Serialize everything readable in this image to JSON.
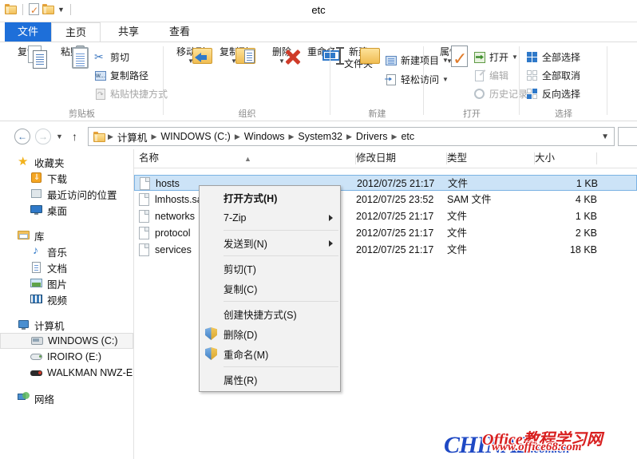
{
  "window": {
    "title": "etc",
    "quick_access": [
      "folder-icon",
      "new-doc-icon",
      "folder-icon",
      "dropdown-caret"
    ]
  },
  "ribbon": {
    "tabs": [
      {
        "id": "file",
        "label": "文件"
      },
      {
        "id": "home",
        "label": "主页"
      },
      {
        "id": "share",
        "label": "共享"
      },
      {
        "id": "view",
        "label": "查看"
      }
    ],
    "active_tab": "home",
    "groups": [
      {
        "id": "clipboard",
        "label": "剪贴板",
        "big_buttons": [
          {
            "id": "copy",
            "label": "复制",
            "icon": "copy-icon"
          },
          {
            "id": "paste",
            "label": "粘贴",
            "icon": "paste-icon"
          }
        ],
        "small_buttons": [
          {
            "id": "cut",
            "label": "剪切",
            "icon": "scissors-icon",
            "disabled": false
          },
          {
            "id": "copy-path",
            "label": "复制路径",
            "icon": "copy-path-icon",
            "disabled": false
          },
          {
            "id": "paste-shortcut",
            "label": "粘贴快捷方式",
            "icon": "paste-shortcut-icon",
            "disabled": true
          }
        ]
      },
      {
        "id": "organize",
        "label": "组织",
        "big_buttons": [
          {
            "id": "move-to",
            "label": "移动到",
            "icon": "move-to-icon"
          },
          {
            "id": "copy-to",
            "label": "复制到",
            "icon": "copy-to-icon"
          },
          {
            "id": "delete",
            "label": "删除",
            "icon": "delete-x-icon"
          },
          {
            "id": "rename",
            "label": "重命名",
            "icon": "rename-icon"
          }
        ],
        "small_buttons": []
      },
      {
        "id": "new",
        "label": "新建",
        "big_buttons": [
          {
            "id": "new-folder",
            "label": "新建\n文件夹",
            "icon": "new-folder-icon"
          }
        ],
        "small_buttons": [
          {
            "id": "new-item",
            "label": "新建项目",
            "icon": "new-item-icon",
            "disabled": false
          },
          {
            "id": "easy-access",
            "label": "轻松访问",
            "icon": "easy-access-icon",
            "disabled": false
          }
        ]
      },
      {
        "id": "open",
        "label": "打开",
        "big_buttons": [
          {
            "id": "properties",
            "label": "属性",
            "icon": "properties-icon"
          }
        ],
        "small_buttons": [
          {
            "id": "open",
            "label": "打开",
            "icon": "open-icon",
            "disabled": false
          },
          {
            "id": "edit",
            "label": "编辑",
            "icon": "edit-icon",
            "disabled": true
          },
          {
            "id": "history",
            "label": "历史记录",
            "icon": "history-icon",
            "disabled": true
          }
        ]
      },
      {
        "id": "select",
        "label": "选择",
        "big_buttons": [],
        "small_buttons": [
          {
            "id": "select-all",
            "label": "全部选择",
            "icon": "select-all-icon",
            "disabled": false
          },
          {
            "id": "select-none",
            "label": "全部取消",
            "icon": "select-none-icon",
            "disabled": false
          },
          {
            "id": "invert-select",
            "label": "反向选择",
            "icon": "invert-select-icon",
            "disabled": false
          }
        ]
      }
    ]
  },
  "address_bar": {
    "back_icon": "back-arrow-icon",
    "forward_icon": "forward-arrow-icon",
    "recent_icon": "recent-locations-caret",
    "up_icon": "up-arrow-icon",
    "breadcrumbs": [
      "计算机",
      "WINDOWS (C:)",
      "Windows",
      "System32",
      "Drivers",
      "etc"
    ],
    "dropdown_icon": "chevron-down-icon",
    "search_placeholder": ""
  },
  "sidebar": {
    "sections": [
      {
        "id": "favorites",
        "label": "收藏夹",
        "icon": "star-icon",
        "items": [
          {
            "id": "downloads",
            "label": "下载",
            "icon": "downloads-icon"
          },
          {
            "id": "recent",
            "label": "最近访问的位置",
            "icon": "recent-places-icon"
          },
          {
            "id": "desktop",
            "label": "桌面",
            "icon": "desktop-icon"
          }
        ]
      },
      {
        "id": "libraries",
        "label": "库",
        "icon": "library-icon",
        "items": [
          {
            "id": "music",
            "label": "音乐",
            "icon": "music-icon"
          },
          {
            "id": "documents",
            "label": "文档",
            "icon": "documents-icon"
          },
          {
            "id": "pictures",
            "label": "图片",
            "icon": "pictures-icon"
          },
          {
            "id": "videos",
            "label": "视频",
            "icon": "videos-icon"
          }
        ]
      },
      {
        "id": "computer",
        "label": "计算机",
        "icon": "computer-icon",
        "items": [
          {
            "id": "drive-c",
            "label": "WINDOWS (C:)",
            "icon": "hard-drive-icon",
            "selected": true
          },
          {
            "id": "drive-e",
            "label": "IROIRO (E:)",
            "icon": "optical-drive-icon",
            "selected": false
          },
          {
            "id": "walkman",
            "label": "WALKMAN NWZ-E",
            "icon": "portable-device-icon",
            "selected": false
          }
        ]
      },
      {
        "id": "network",
        "label": "网络",
        "icon": "network-icon",
        "items": []
      }
    ]
  },
  "file_list": {
    "columns": [
      {
        "id": "name",
        "label": "名称",
        "sorted": true,
        "sort_dir": "asc"
      },
      {
        "id": "date",
        "label": "修改日期"
      },
      {
        "id": "type",
        "label": "类型"
      },
      {
        "id": "size",
        "label": "大小"
      }
    ],
    "rows": [
      {
        "name": "hosts",
        "date": "2012/07/25 21:17",
        "type": "文件",
        "size": "1 KB",
        "selected": true,
        "icon": "file-icon"
      },
      {
        "name": "lmhosts.sam",
        "date": "2012/07/25 23:52",
        "type": "SAM 文件",
        "size": "4 KB",
        "selected": false,
        "icon": "file-icon"
      },
      {
        "name": "networks",
        "date": "2012/07/25 21:17",
        "type": "文件",
        "size": "1 KB",
        "selected": false,
        "icon": "file-icon"
      },
      {
        "name": "protocol",
        "date": "2012/07/25 21:17",
        "type": "文件",
        "size": "2 KB",
        "selected": false,
        "icon": "file-icon"
      },
      {
        "name": "services",
        "date": "2012/07/25 21:17",
        "type": "文件",
        "size": "18 KB",
        "selected": false,
        "icon": "file-icon"
      }
    ]
  },
  "context_menu": {
    "items": [
      {
        "id": "open-with",
        "label": "打开方式(H)",
        "bold": true,
        "submenu": false,
        "shield": false
      },
      {
        "id": "seven-zip",
        "label": "7-Zip",
        "bold": false,
        "submenu": true,
        "shield": false
      },
      {
        "id": "sep1",
        "separator": true
      },
      {
        "id": "send-to",
        "label": "发送到(N)",
        "bold": false,
        "submenu": true,
        "shield": false
      },
      {
        "id": "sep2",
        "separator": true
      },
      {
        "id": "cut",
        "label": "剪切(T)",
        "bold": false,
        "submenu": false,
        "shield": false
      },
      {
        "id": "copy",
        "label": "复制(C)",
        "bold": false,
        "submenu": false,
        "shield": false
      },
      {
        "id": "sep3",
        "separator": true
      },
      {
        "id": "create-shortcut",
        "label": "创建快捷方式(S)",
        "bold": false,
        "submenu": false,
        "shield": false
      },
      {
        "id": "delete",
        "label": "删除(D)",
        "bold": false,
        "submenu": false,
        "shield": true
      },
      {
        "id": "rename",
        "label": "重命名(M)",
        "bold": false,
        "submenu": false,
        "shield": true
      },
      {
        "id": "sep4",
        "separator": true
      },
      {
        "id": "properties",
        "label": "属性(R)",
        "bold": false,
        "submenu": false,
        "shield": false
      }
    ]
  },
  "watermarks": {
    "blue_text": "CHINAZ",
    "blue_suffix": ".com.cn",
    "red_line1": "Office教程学习网",
    "red_line2": "www.office68.com"
  },
  "colors": {
    "accent": "#1e6fd9",
    "selection": "#cce3f7",
    "selection_border": "#7ab2e3",
    "watermark_red": "#d81f1f",
    "watermark_blue": "#1f49c4"
  }
}
